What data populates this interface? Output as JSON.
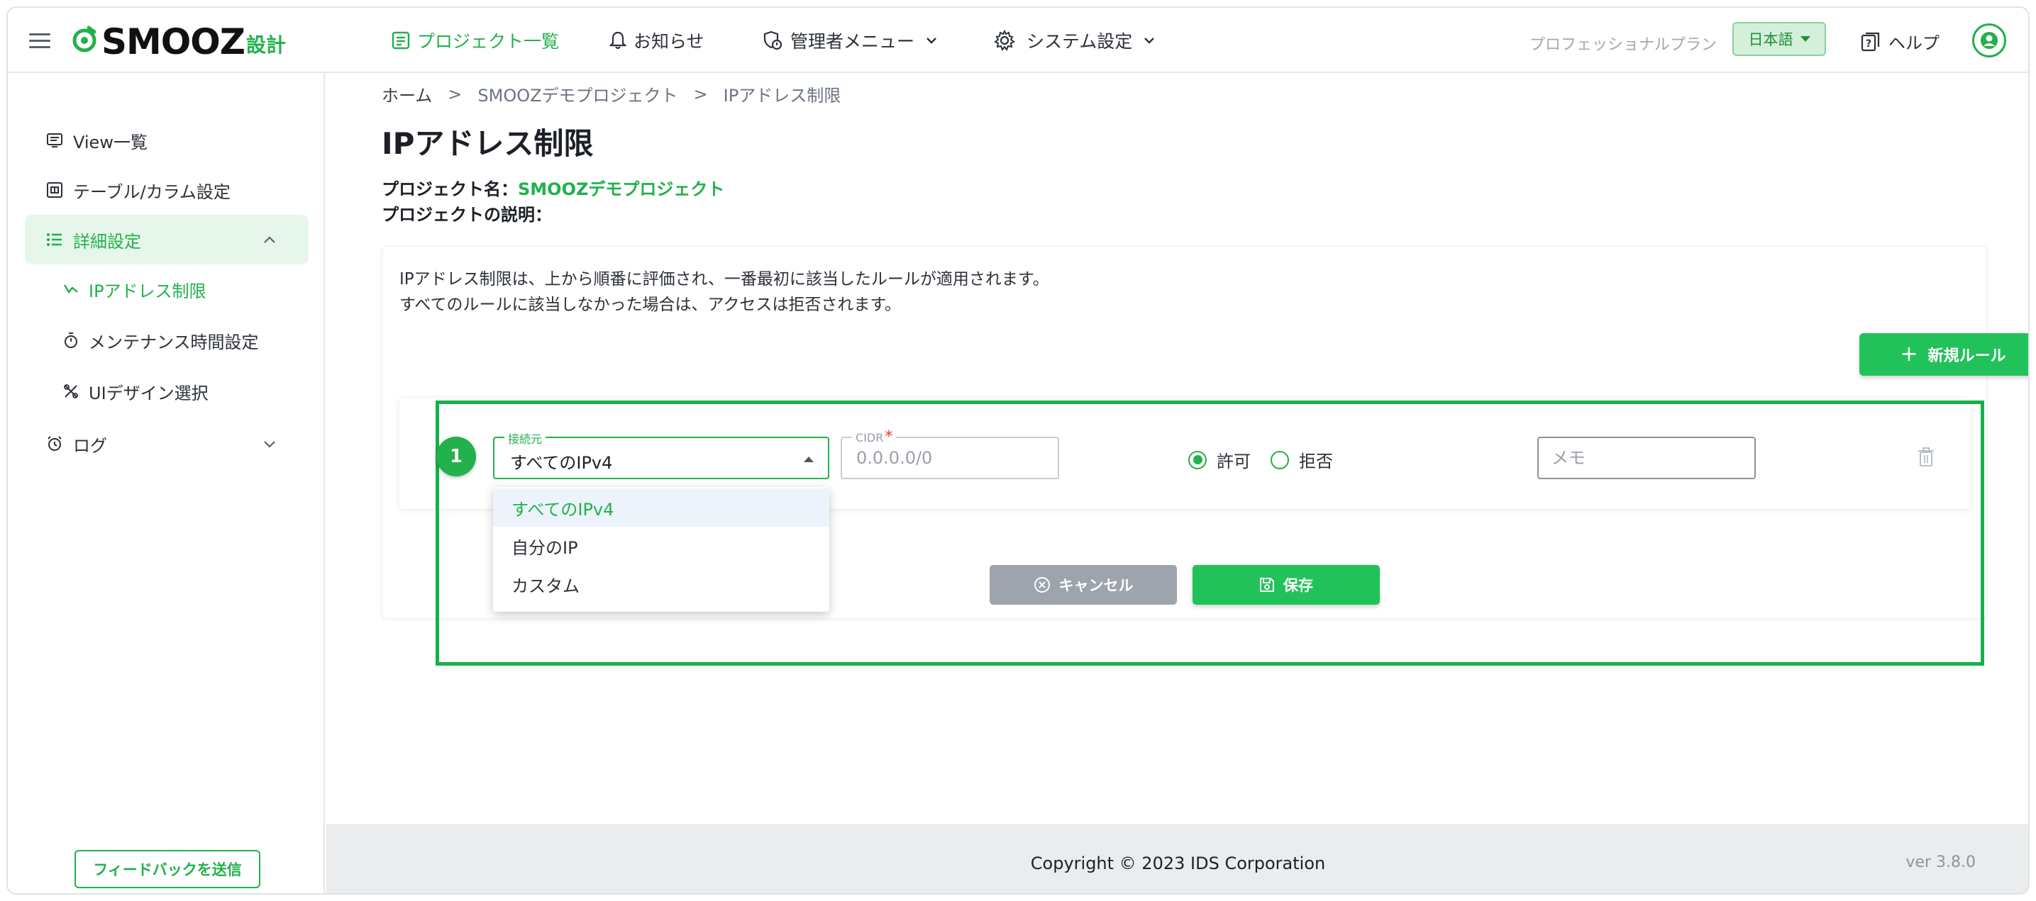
{
  "app": {
    "logo_main": "SMOOZ",
    "logo_sub": "設計"
  },
  "header": {
    "nav": [
      {
        "label": "プロジェクト一覧",
        "icon": "project-list-icon",
        "active": true
      },
      {
        "label": "お知らせ",
        "icon": "bell-icon"
      },
      {
        "label": "管理者メニュー",
        "icon": "admin-icon",
        "has_dropdown": true
      },
      {
        "label": "システム設定",
        "icon": "gear-icon",
        "has_dropdown": true
      }
    ],
    "plan": "プロフェッショナルプラン",
    "language": "日本語",
    "help": "ヘルプ"
  },
  "sidebar": {
    "items": [
      {
        "label": "View一覧",
        "icon": "view-list-icon"
      },
      {
        "label": "テーブル/カラム設定",
        "icon": "table-icon"
      },
      {
        "label": "詳細設定",
        "icon": "list-icon",
        "expanded": true
      },
      {
        "label": "IPアドレス制限",
        "icon": "ip-icon",
        "active": true
      },
      {
        "label": "メンテナンス時間設定",
        "icon": "timer-icon"
      },
      {
        "label": "UIデザイン選択",
        "icon": "design-icon"
      },
      {
        "label": "ログ",
        "icon": "alarm-icon"
      }
    ],
    "feedback": "フィードバックを送信"
  },
  "breadcrumb": {
    "home": "ホーム",
    "project": "SMOOZデモプロジェクト",
    "current": "IPアドレス制限",
    "separator": ">"
  },
  "page": {
    "title": "IPアドレス制限",
    "project_name_label": "プロジェクト名：",
    "project_name": "SMOOZデモプロジェクト",
    "project_desc_label": "プロジェクトの説明："
  },
  "rules": {
    "description_line1": "IPアドレス制限は、上から順番に評価され、一番最初に該当したルールが適用されます。",
    "description_line2": "すべてのルールに該当しなかった場合は、アクセスは拒否されます。",
    "new_rule_button": "新規ルール",
    "row": {
      "number": "1",
      "source_label": "接続元",
      "source_value": "すべてのIPv4",
      "cidr_label": "CIDR",
      "cidr_required": "*",
      "cidr_placeholder": "0.0.0.0/0",
      "allow_label": "許可",
      "deny_label": "拒否",
      "selected_action": "allow",
      "memo_placeholder": "メモ"
    },
    "source_options": [
      "すべてのIPv4",
      "自分のIP",
      "カスタム"
    ],
    "cancel_button": "キャンセル",
    "save_button": "保存"
  },
  "footer": {
    "copyright": "Copyright © 2023 IDS Corporation",
    "version": "ver 3.8.0"
  },
  "colors": {
    "accent": "#22b14c",
    "accent_button": "#22c25a",
    "cancel_button": "#9ea4ad",
    "highlight_border": "#16b04a",
    "footer_bg": "#ebecee"
  }
}
